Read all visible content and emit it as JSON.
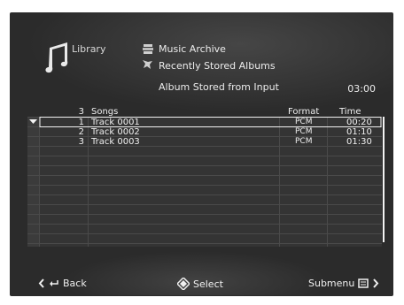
{
  "header": {
    "library_label": "Library",
    "line1": "Music Archive",
    "line2": "Recently Stored Albums",
    "line3": "Album Stored from Input",
    "duration": "03:00"
  },
  "table": {
    "count": "3",
    "col_songs": "Songs",
    "col_format": "Format",
    "col_time": "Time",
    "rows": [
      {
        "num": "1",
        "title": "Track 0001",
        "format": "PCM",
        "time": "00:20"
      },
      {
        "num": "2",
        "title": "Track 0002",
        "format": "PCM",
        "time": "01:10"
      },
      {
        "num": "3",
        "title": "Track 0003",
        "format": "PCM",
        "time": "01:30"
      }
    ]
  },
  "footer": {
    "back_label": "Back",
    "select_label": "Select",
    "submenu_label": "Submenu"
  }
}
